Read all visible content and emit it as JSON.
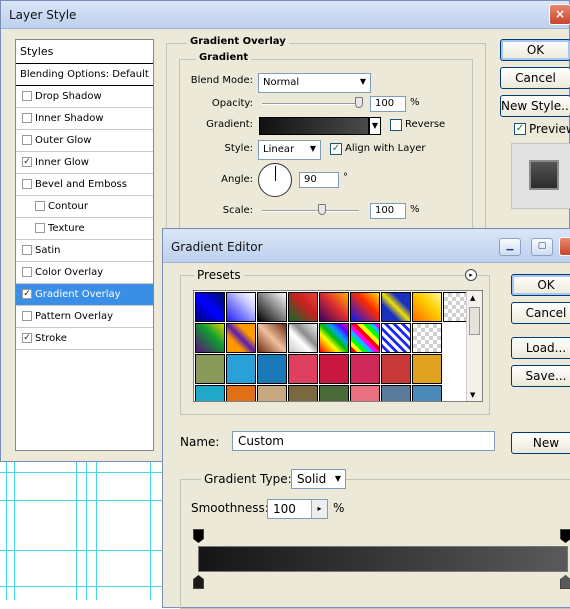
{
  "layer_style": {
    "title": "Layer Style",
    "close": "×",
    "styles_header": "Styles",
    "items": [
      {
        "label": "Blending Options: Default",
        "check": ""
      },
      {
        "label": "Drop Shadow",
        "check": ""
      },
      {
        "label": "Inner Shadow",
        "check": ""
      },
      {
        "label": "Outer Glow",
        "check": ""
      },
      {
        "label": "Inner Glow",
        "check": "✓"
      },
      {
        "label": "Bevel and Emboss",
        "check": ""
      },
      {
        "label": "Contour",
        "check": ""
      },
      {
        "label": "Texture",
        "check": ""
      },
      {
        "label": "Satin",
        "check": ""
      },
      {
        "label": "Color Overlay",
        "check": ""
      },
      {
        "label": "Gradient Overlay",
        "check": "✓"
      },
      {
        "label": "Pattern Overlay",
        "check": ""
      },
      {
        "label": "Stroke",
        "check": "✓"
      }
    ],
    "section_title": "Gradient Overlay",
    "group_title": "Gradient",
    "blend_mode_label": "Blend Mode:",
    "blend_mode_value": "Normal",
    "opacity_label": "Opacity:",
    "opacity_value": "100",
    "opacity_unit": "%",
    "gradient_label": "Gradient:",
    "reverse_label": "Reverse",
    "style_label": "Style:",
    "style_value": "Linear",
    "align_label": "Align with Layer",
    "align_check": "✓",
    "angle_label": "Angle:",
    "angle_value": "90",
    "angle_unit": "°",
    "scale_label": "Scale:",
    "scale_value": "100",
    "scale_unit": "%",
    "ok": "OK",
    "cancel": "Cancel",
    "new_style": "New Style...",
    "preview_label": "Preview",
    "preview_check": "✓"
  },
  "gradient_editor": {
    "title": "Gradient Editor",
    "minimize": "▁",
    "maximize": "▢",
    "presets_label": "Presets",
    "presets_menu": "▸",
    "ok": "OK",
    "cancel": "Cancel",
    "load": "Load...",
    "save": "Save...",
    "name_label": "Name:",
    "name_value": "Custom",
    "new": "New",
    "gradient_type_label": "Gradient Type:",
    "gradient_type_value": "Solid",
    "smoothness_label": "Smoothness:",
    "smoothness_value": "100",
    "smoothness_unit": "%"
  },
  "icons": {
    "dropdown": "dropdown-arrow-icon",
    "scroll": "scrollbar-arrow-icon",
    "stop": "color-stop-icon"
  },
  "colors": {
    "selection": "#3a8ee6",
    "window_bg": "#ece9d8",
    "guides": "#41d8e8",
    "gradient_start": "#151515",
    "gradient_end": "#5a5a5a"
  }
}
